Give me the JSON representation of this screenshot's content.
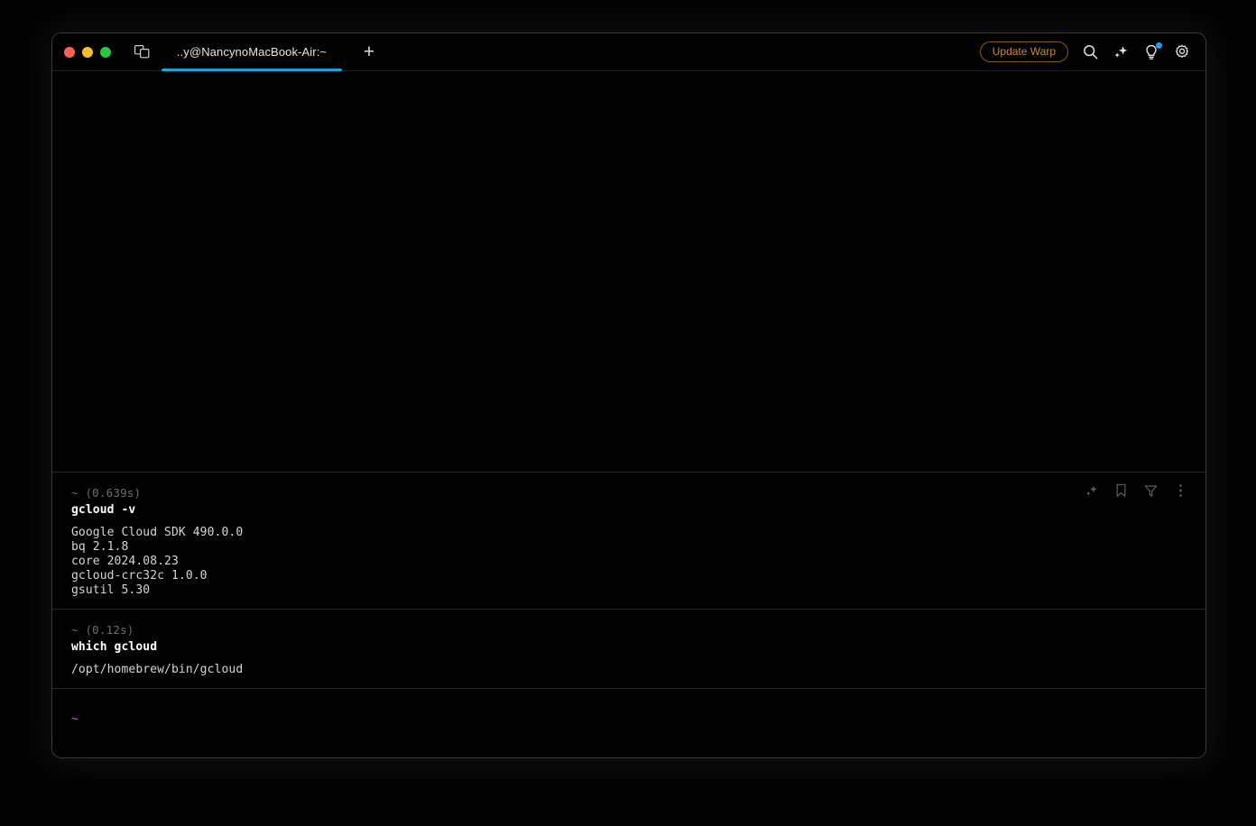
{
  "window": {
    "traffic_lights": [
      {
        "name": "close",
        "color": "#FF5F57"
      },
      {
        "name": "minimize",
        "color": "#FEBC2E"
      },
      {
        "name": "zoom",
        "color": "#28C840"
      }
    ],
    "split_pane_icon": "split-pane-icon",
    "tab": {
      "label": "..y@NancynoMacBook-Air:~",
      "active": true,
      "underline_color": "#17A2E0"
    },
    "new_tab_label": "+",
    "right_controls": {
      "update_button": {
        "label": "Update Warp",
        "border_color": "#8a5c13",
        "text_color": "#D08A25"
      },
      "icons": [
        {
          "name": "search-icon",
          "glyph": "search"
        },
        {
          "name": "sparkle-icon",
          "glyph": "sparkle"
        },
        {
          "name": "lightbulb-icon",
          "glyph": "lightbulb",
          "badge": true,
          "badge_color": "#1E9FFF"
        },
        {
          "name": "gear-icon",
          "glyph": "gear"
        }
      ]
    }
  },
  "terminal": {
    "blocks": [
      {
        "header": "~ (0.639s)",
        "command": "gcloud -v",
        "output": "Google Cloud SDK 490.0.0\nbq 2.1.8\ncore 2024.08.23\ngcloud-crc32c 1.0.0\ngsutil 5.30",
        "actions": [
          {
            "name": "sparkle-icon",
            "glyph": "sparkle"
          },
          {
            "name": "bookmark-icon",
            "glyph": "bookmark"
          },
          {
            "name": "filter-icon",
            "glyph": "funnel"
          },
          {
            "name": "more-icon",
            "glyph": "kebab"
          }
        ]
      },
      {
        "header": "~ (0.12s)",
        "command": "which gcloud",
        "output": "/opt/homebrew/bin/gcloud",
        "actions": []
      }
    ],
    "prompt": {
      "symbol": "~",
      "color": "#C857D8"
    }
  }
}
